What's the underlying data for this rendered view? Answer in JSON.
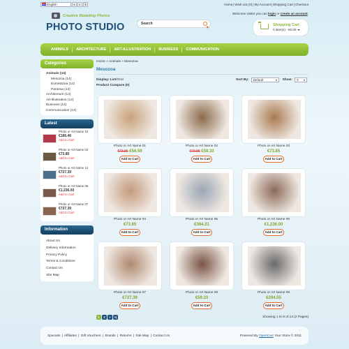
{
  "topbar": {
    "language": "English",
    "currency_buttons": [
      "€",
      "£",
      "$"
    ],
    "links": [
      "Home",
      "|",
      "Wish List (0)",
      "|",
      "My Account",
      "|",
      "Shopping Cart",
      "|",
      "Checkout"
    ]
  },
  "header": {
    "tagline": "Creative Modeling Photos",
    "title": "PHOTO STUDIO",
    "welcome_prefix": "Welcome visitor you can ",
    "login": "login",
    "welcome_mid": " or ",
    "register": "create an account",
    "welcome_suffix": ".",
    "search_placeholder": "Search",
    "cart_title": "Shopping Cart",
    "cart_summary": "0 item(s) - €0.00"
  },
  "nav": [
    "ANIMALS",
    "ARCHITECTURE",
    "ART-ILLUSTRATION",
    "BUSINESS",
    "COMMUNICATION"
  ],
  "categories": {
    "heading": "Categories",
    "items": [
      {
        "label": "Animals (14)",
        "bold": true,
        "sub": false
      },
      {
        "label": "Mesozoa (14)",
        "bold": false,
        "sub": true
      },
      {
        "label": "Eumetazoa (14)",
        "bold": false,
        "sub": true
      },
      {
        "label": "Parazoa (14)",
        "bold": false,
        "sub": true
      },
      {
        "label": "Architecture (14)",
        "bold": false,
        "sub": false
      },
      {
        "label": "Art-Illustration (14)",
        "bold": false,
        "sub": false
      },
      {
        "label": "Business (14)",
        "bold": false,
        "sub": false
      },
      {
        "label": "Communication (14)",
        "bold": false,
        "sub": false
      }
    ]
  },
  "latest": {
    "heading": "Latest",
    "items": [
      {
        "name": "Photo or Art Name 10",
        "price": "€186.46",
        "add": "Add to Cart",
        "color": "#b33a4a"
      },
      {
        "name": "Photo or Art Name 02",
        "price": "€73.85",
        "add": "Add to Cart",
        "color": "#6a5a44"
      },
      {
        "name": "Photo or Art Name 12",
        "price": "€727.39",
        "add": "Add to Cart",
        "color": "#4b6f8c"
      },
      {
        "name": "Photo or Art Name 06",
        "price": "€1,236.00",
        "add": "Add to Cart",
        "color": "#7a5a4c"
      },
      {
        "name": "Photo or Art Name 07",
        "price": "€727.39",
        "add": "Add to Cart",
        "color": "#8a6450"
      }
    ]
  },
  "information": {
    "heading": "Information",
    "items": [
      "About Us",
      "Delivery Information",
      "Privacy Policy",
      "Terms & Conditions",
      "Contact Us",
      "Site Map"
    ]
  },
  "main": {
    "breadcrumb": "Home  »  Animals  »  Mesozoa",
    "title": "Mesozoa",
    "display_label": "Display:",
    "display_list": "List",
    "display_sep": " / ",
    "display_grid": "Grid",
    "sort_label": "Sort By:",
    "sort_value": "Default",
    "show_label": "Show:",
    "show_value": "0",
    "compare": "Product Compare (0)"
  },
  "products": [
    {
      "name": "Photo or Art Name 01",
      "old_price": "€73.85",
      "price": "€56.59",
      "button": "Add to Cart",
      "color": "#c9a27a"
    },
    {
      "name": "Photo or Art Name 02",
      "old_price": "€73.85",
      "price": "€59.33",
      "button": "Add to Cart",
      "color": "#8a6a4a"
    },
    {
      "name": "Photo or Art Name 03",
      "old_price": "",
      "price": "€73.85",
      "button": "Add to Cart",
      "color": "#a97a52"
    },
    {
      "name": "Photo or Art Name 04",
      "old_price": "",
      "price": "€73.85",
      "button": "Add to Cart",
      "color": "#c59a7c"
    },
    {
      "name": "Photo or Art Name 05",
      "old_price": "",
      "price": "€364.31",
      "button": "Add to Cart",
      "color": "#9aa6b4"
    },
    {
      "name": "Photo or Art Name 06",
      "old_price": "",
      "price": "€1,236.00",
      "button": "Add to Cart",
      "color": "#8c6a58"
    },
    {
      "name": "Photo or Art Name 07",
      "old_price": "",
      "price": "€727.39",
      "button": "Add to Cart",
      "color": "#b08a70"
    },
    {
      "name": "Photo or Art Name 08",
      "old_price": "",
      "price": "€59.33",
      "button": "Add to Cart",
      "color": "#7a5444"
    },
    {
      "name": "Photo or Art Name 09",
      "old_price": "",
      "price": "€204.55",
      "button": "Add to Cart",
      "color": "#6a6a6a"
    }
  ],
  "pagination": {
    "pages": [
      "1",
      "2",
      ">",
      ">|"
    ],
    "showing": "Showing 1 to 9 of 14 (2 Pages)"
  },
  "footer": {
    "links": [
      "Specials",
      "|",
      "Affiliates",
      "|",
      "Gift Vouchers",
      "|",
      "Brands",
      "|",
      "Returns",
      "|",
      "Site Map",
      "|",
      "Contact Us"
    ],
    "powered_prefix": "Powered By ",
    "powered_link": "OpenCart",
    "powered_suffix": " Your Store © 2011"
  }
}
